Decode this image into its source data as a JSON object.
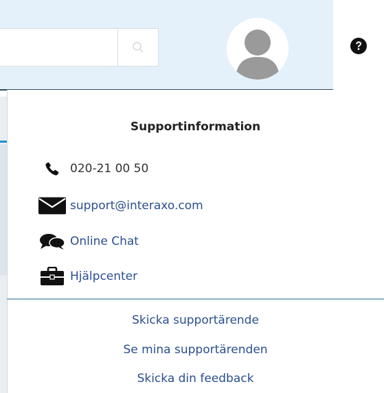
{
  "header": {
    "search": {
      "placeholder": "",
      "value": ""
    }
  },
  "support": {
    "title": "Supportinformation",
    "phone": "020-21 00 50",
    "email": "support@interaxo.com",
    "chat": "Online Chat",
    "helpcenter": "Hjälpcenter"
  },
  "actions": {
    "send_ticket": "Skicka supportärende",
    "my_tickets": "Se mina supportärenden",
    "feedback": "Skicka din feedback"
  },
  "colors": {
    "header_bg": "#e4f1fa",
    "link": "#2a4f8f",
    "divider": "#8ab3cc"
  }
}
